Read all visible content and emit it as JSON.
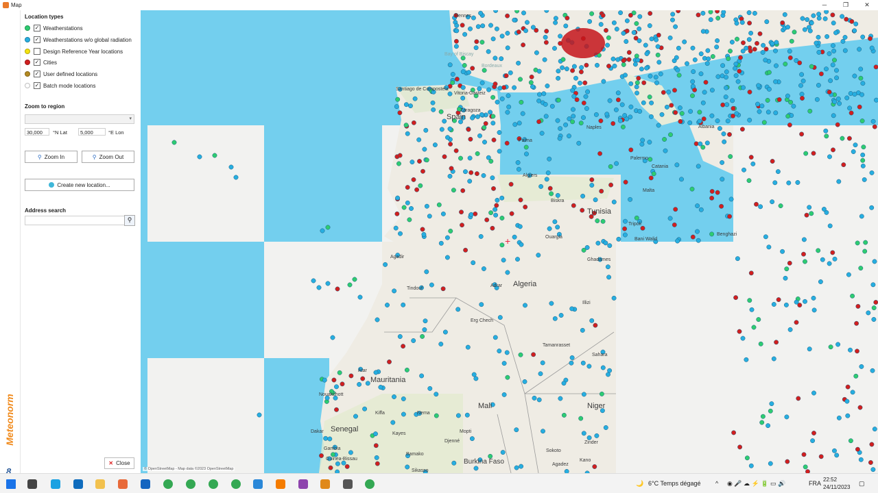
{
  "window": {
    "title": "Map",
    "controls": [
      "─",
      "❐",
      "✕"
    ]
  },
  "brand": {
    "name": "Meteonorm",
    "version": "8",
    "color": "#f08a1c"
  },
  "panel": {
    "location_types": {
      "title": "Location types",
      "items": [
        {
          "label": "Weatherstations",
          "checked": true,
          "check_mark": "✓",
          "color": "#2ecc71"
        },
        {
          "label": "Weatherstations w/o global radiation",
          "checked": true,
          "check_mark": "✓",
          "color": "#27aee0"
        },
        {
          "label": "Design Reference Year locations",
          "checked": false,
          "check_mark": "",
          "color": "#f4e310"
        },
        {
          "label": "Cities",
          "checked": true,
          "check_mark": "✓",
          "color": "#d11f1f"
        },
        {
          "label": "User defined locations",
          "checked": true,
          "check_mark": "✓",
          "color": "#b48a22"
        },
        {
          "label": "Batch mode locations",
          "checked": true,
          "check_mark": "✓",
          "color": "#ffffff"
        }
      ]
    },
    "zoom": {
      "title": "Zoom to region",
      "region_value": "",
      "lat_value": "30,000",
      "lat_label": "°N Lat",
      "lon_value": "5,000",
      "lon_label": "°E Lon",
      "zoom_in_label": "Zoom In",
      "zoom_out_label": "Zoom Out",
      "create_label": "Create new location..."
    },
    "address": {
      "title": "Address search",
      "value": "",
      "button_icon": "magnifier-icon"
    },
    "close_label": "Close"
  },
  "map": {
    "attribution": "© OpenStreetMap - Map data ©2023 OpenStreetMap",
    "colors": {
      "sea": "#73cfee",
      "land": "#efece4",
      "blank": "#f2f2f0"
    },
    "large_labels": [
      {
        "text": "Spain"
      },
      {
        "text": "Tunisia"
      },
      {
        "text": "Algeria"
      },
      {
        "text": "Mauritania"
      },
      {
        "text": "Mali"
      },
      {
        "text": "Niger"
      },
      {
        "text": "Senegal"
      },
      {
        "text": "Burkina Faso"
      }
    ],
    "small_labels": [
      {
        "text": "Rennes"
      },
      {
        "text": "Bay of Biscay"
      },
      {
        "text": "Bordeaux"
      },
      {
        "text": "Santiago de Compostela"
      },
      {
        "text": "Vitoria-Gasteiz"
      },
      {
        "text": "Zaragoza"
      },
      {
        "text": "Palma"
      },
      {
        "text": "Naples"
      },
      {
        "text": "Albania"
      },
      {
        "text": "Palermo"
      },
      {
        "text": "Catania"
      },
      {
        "text": "Malta"
      },
      {
        "text": "Algiers"
      },
      {
        "text": "Biskra"
      },
      {
        "text": "Tripoli"
      },
      {
        "text": "Bani Walid"
      },
      {
        "text": "Benghazi"
      },
      {
        "text": "Agadir"
      },
      {
        "text": "Tindouf"
      },
      {
        "text": "Ouargla"
      },
      {
        "text": "Ghadames"
      },
      {
        "text": "Adrar"
      },
      {
        "text": "Erg Chech"
      },
      {
        "text": "Illizi"
      },
      {
        "text": "Tamanrasset"
      },
      {
        "text": "Sahara"
      },
      {
        "text": "Atar"
      },
      {
        "text": "Nouakchott"
      },
      {
        "text": "Kiffa"
      },
      {
        "text": "Nema"
      },
      {
        "text": "Dakar"
      },
      {
        "text": "Gambia"
      },
      {
        "text": "Guinea-Bissau"
      },
      {
        "text": "Kayes"
      },
      {
        "text": "Bamako"
      },
      {
        "text": "Mopti"
      },
      {
        "text": "Djenné"
      },
      {
        "text": "Sikasso"
      },
      {
        "text": "Zinder"
      },
      {
        "text": "Sokoto"
      },
      {
        "text": "Kano"
      },
      {
        "text": "Agadez"
      }
    ]
  },
  "taskbar": {
    "weather": "6°C  Temps dégagé",
    "lang": "FRA",
    "time": "22:52",
    "date": "24/11/2023",
    "icons": [
      "windows-icon",
      "task-view-icon",
      "edge-icon",
      "outlook-icon",
      "explorer-icon",
      "app-icon",
      "mail-icon",
      "chrome-icon",
      "chrome-icon",
      "chrome-icon",
      "chrome-icon",
      "remote-icon",
      "app-icon",
      "brave-icon",
      "app-icon",
      "app-icon",
      "chrome-icon"
    ]
  }
}
